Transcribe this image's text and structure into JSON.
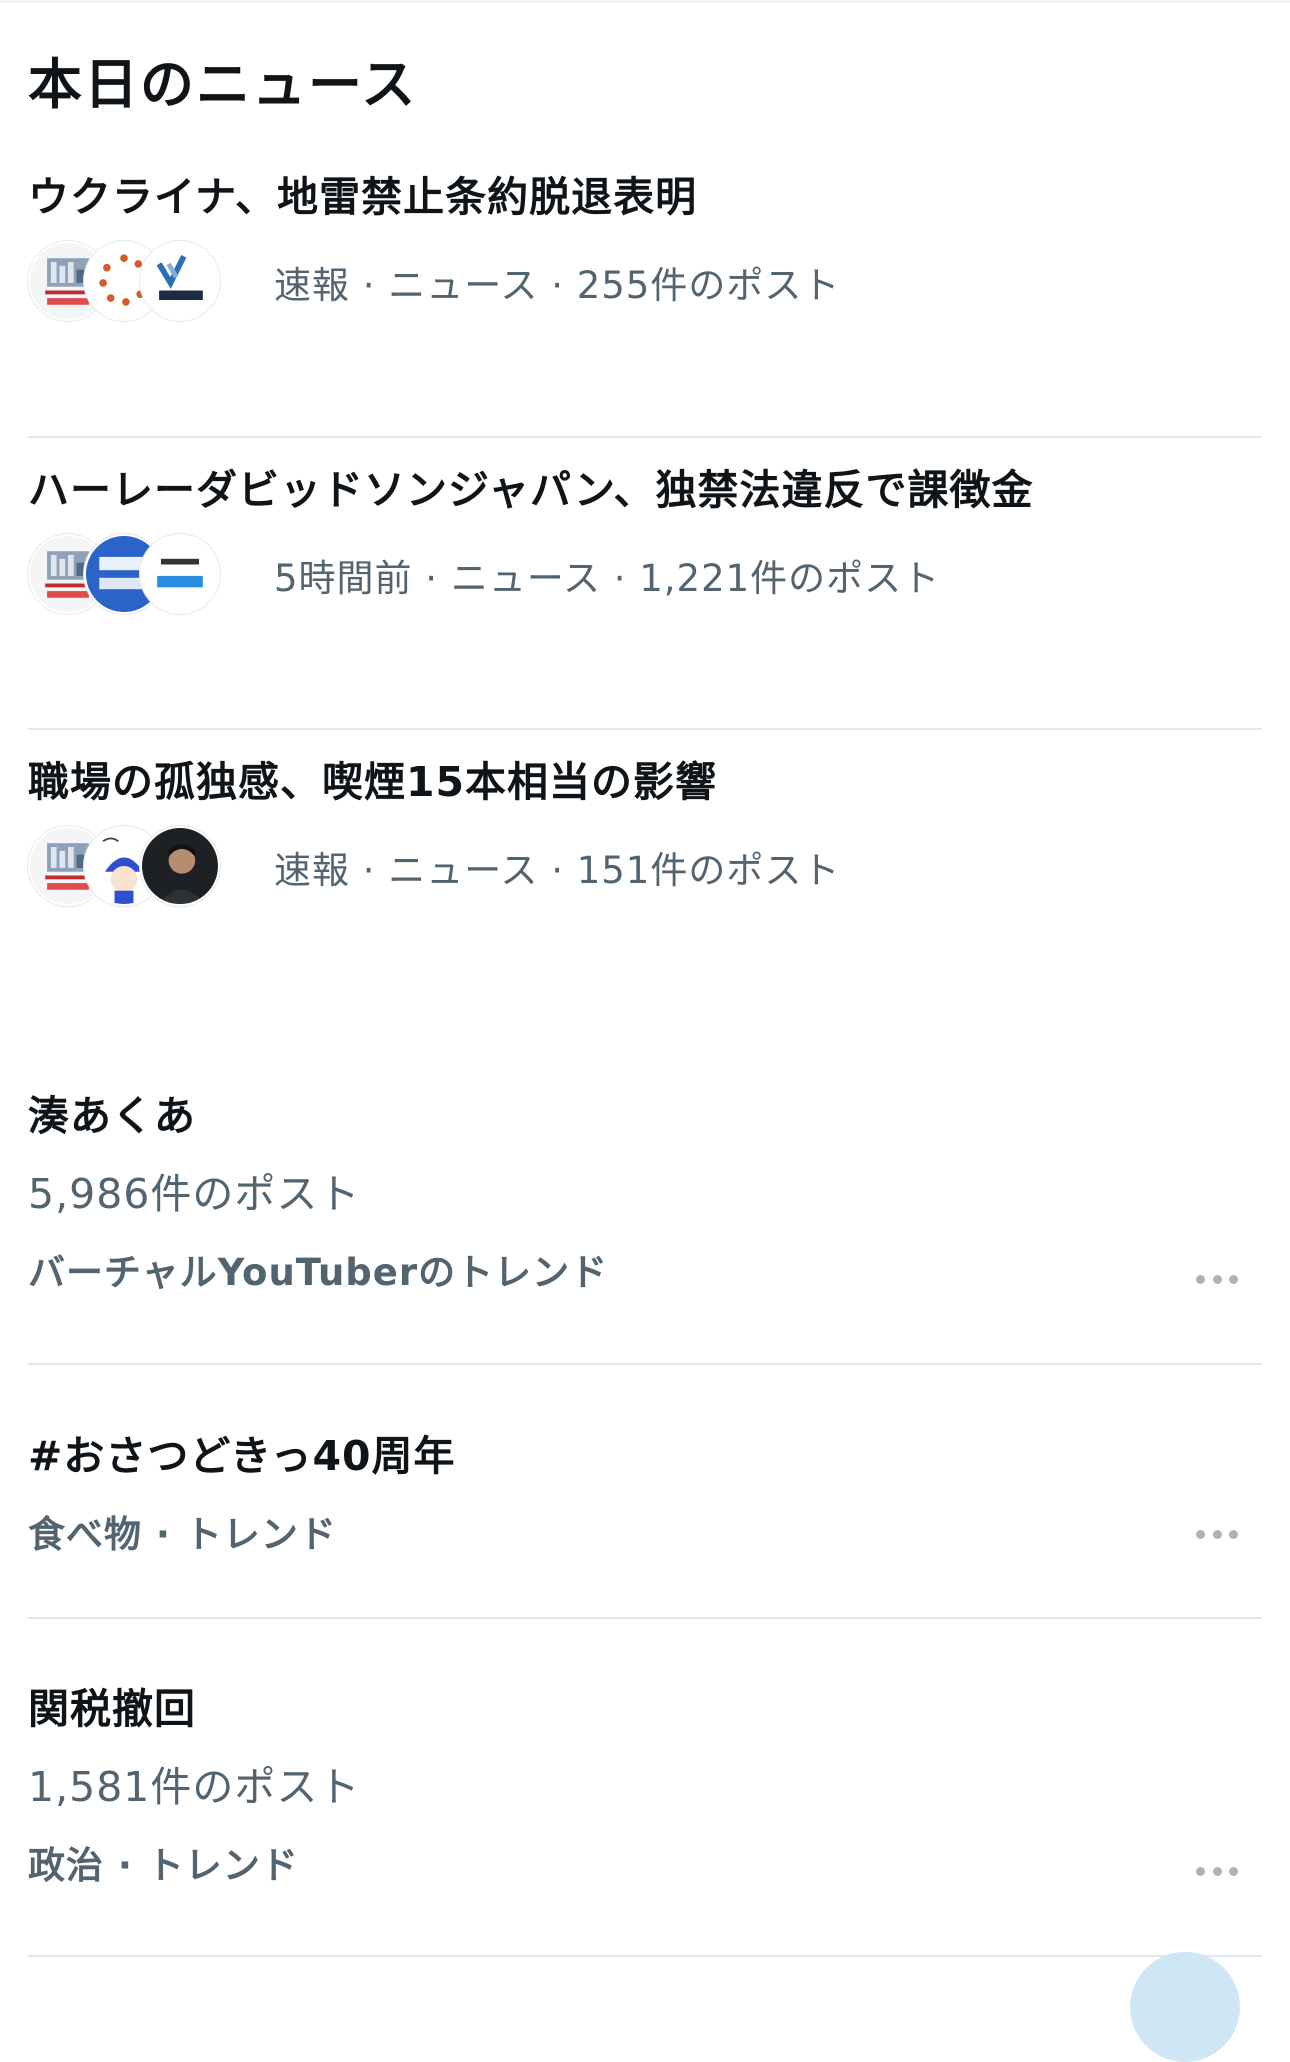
{
  "section": {
    "title": "本日のニュース"
  },
  "news": [
    {
      "headline": "ウクライナ、地雷禁止条約脱退表明",
      "meta": "速報 · ニュース · 255件のポスト",
      "avatars": [
        "yahoo-news-logo",
        "orange-dots-logo",
        "news-dotcom-logo"
      ]
    },
    {
      "headline": "ハーレーダビッドソンジャパン、独禁法違反で課徴金",
      "meta": "5時間前 · ニュース · 1,221件のポスト",
      "avatars": [
        "yahoo-news-logo",
        "nhk-news-logo",
        "livedoor-news-logo"
      ]
    },
    {
      "headline": "職場の孤独感、喫煙15本相当の影響",
      "meta": "速報 · ニュース · 151件のポスト",
      "avatars": [
        "yahoo-news-logo",
        "anime-character-avatar",
        "man-portrait-avatar"
      ]
    }
  ],
  "trends": [
    {
      "title": "湊あくあ",
      "count": "5,986件のポスト",
      "category": "バーチャルYouTuberのトレンド",
      "more_icon": "more-dots-icon"
    },
    {
      "title": "#おさつどきっ40周年",
      "count": "",
      "category": "食べ物 · トレンド",
      "more_icon": "more-dots-icon"
    },
    {
      "title": "関税撤回",
      "count": "1,581件のポスト",
      "category": "政治 · トレンド",
      "more_icon": "more-dots-icon"
    }
  ],
  "colors": {
    "primary_text": "#0f1419",
    "secondary_text": "#536471",
    "divider": "#e2e6e8",
    "accent": "#1d9bf0"
  }
}
